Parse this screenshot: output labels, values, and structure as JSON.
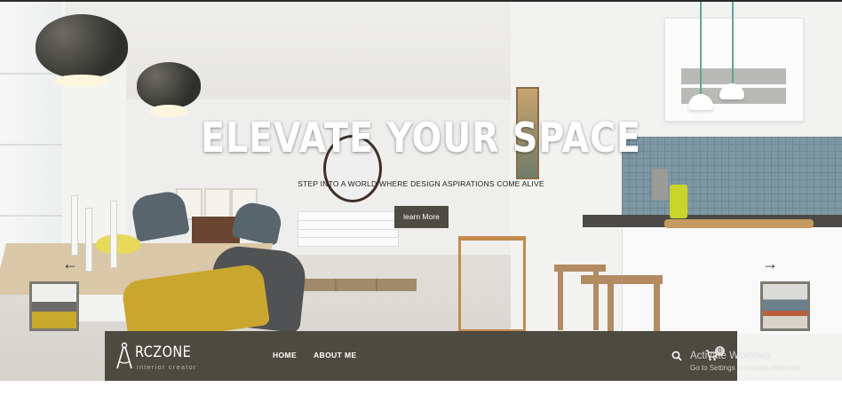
{
  "hero": {
    "title": "ELEVATE YOUR SPACE",
    "subtitle": "STEP INTO A WORLD WHERE DESIGN ASPIRATIONS COME ALIVE",
    "cta_label": "learn More"
  },
  "carousel": {
    "prev_arrow": "←",
    "next_arrow": "→"
  },
  "navbar": {
    "logo_name": "RCZONE",
    "logo_tagline": "interior creator",
    "links": [
      "HOME",
      "ABOUT ME"
    ],
    "cart_count": "0",
    "icons": {
      "search": "search-icon",
      "cart": "cart-icon",
      "logo": "compass-icon"
    }
  },
  "watermark": {
    "title": "Activate Windows",
    "subtitle": "Go to Settings to activate Windows."
  },
  "colors": {
    "nav_background": "#4d4b40",
    "cta_background": "#4d4b42",
    "hero_text": "#ffffff"
  }
}
